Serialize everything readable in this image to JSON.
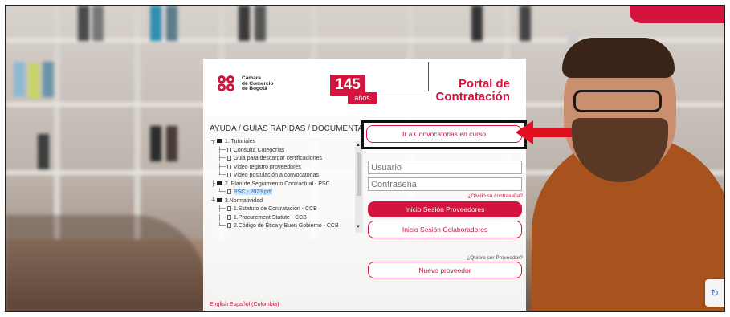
{
  "logo": {
    "line1": "Cámara",
    "line2": "de Comercio",
    "line3": "de Bogotá"
  },
  "anniversary": {
    "number": "145",
    "word": "años"
  },
  "portal": {
    "title_line1": "Portal de",
    "title_line2": "Contratación"
  },
  "help": {
    "title": "AYUDA / GUÍAS RÁPIDAS / DOCUMENTACIÓN",
    "tree": [
      {
        "label": "1. Tutoriales",
        "type": "folder"
      },
      {
        "label": "Consulta Categorias",
        "type": "file"
      },
      {
        "label": "Guia para descargar certificaciones",
        "type": "file"
      },
      {
        "label": "Video registro proveedores",
        "type": "file"
      },
      {
        "label": "Video postulación a convocatorias",
        "type": "file"
      },
      {
        "label": "2. Plan de Seguimiento Contractual - PSC",
        "type": "folder"
      },
      {
        "label": "PSC - 2023.pdf",
        "type": "file"
      },
      {
        "label": "3.Normatividad",
        "type": "folder"
      },
      {
        "label": "1.Estatuto de Contratación - CCB",
        "type": "file"
      },
      {
        "label": "1.Procurement Statute - CCB",
        "type": "file"
      },
      {
        "label": "2.Código de Ética y Buen Gobierno - CCB",
        "type": "file"
      }
    ]
  },
  "language": {
    "english": "English",
    "spanish": "Español (Colombia)"
  },
  "form": {
    "convocatorias_button": "Ir a Convocatorias en curso",
    "user_placeholder": "Usuario",
    "password_placeholder": "Contraseña",
    "forgot_password": "¿Olvidó su contraseña?",
    "login_providers": "Inicio Sesión Proveedores",
    "login_collaborators": "Inicio Sesión Colaboradores",
    "want_provider": "¿Quiere ser Proveedor?",
    "new_provider": "Nuevo proveedor"
  },
  "colors": {
    "brand_red": "#d4143f",
    "highlight_box": "#111111",
    "arrow": "#e10f1f"
  },
  "icons": {
    "tree_folder": "folder-icon",
    "tree_file": "file-icon",
    "annotation_arrow": "left-arrow-icon"
  }
}
